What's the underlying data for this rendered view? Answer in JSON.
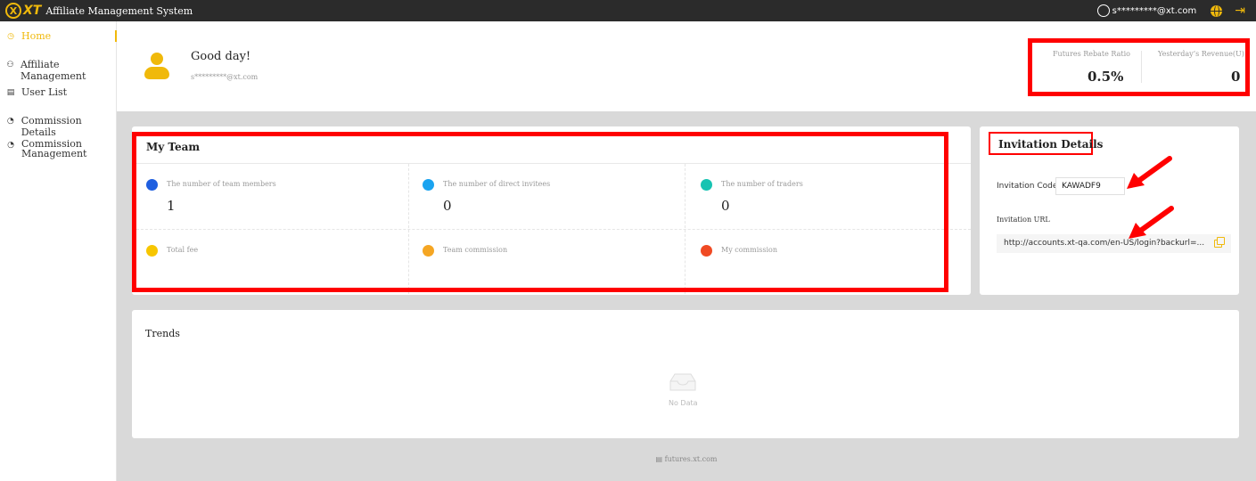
{
  "topbar": {
    "logo_mark": "X",
    "logo_text": "XT",
    "title": "Affiliate Management System",
    "user_email": "s*********@xt.com"
  },
  "sidebar": {
    "items": [
      {
        "label": "Home",
        "icon": "home-icon",
        "active": true
      },
      {
        "label": "Affiliate Management",
        "icon": "users-icon"
      },
      {
        "label": "User List",
        "icon": "list-icon"
      },
      {
        "label": "Commission Details",
        "icon": "pie-chart-icon"
      },
      {
        "label": "Commission Management",
        "icon": "pie-chart-icon"
      }
    ]
  },
  "header": {
    "greeting": "Good day!",
    "email": "s*********@xt.com",
    "stats": [
      {
        "label": "Futures Rebate Ratio",
        "value": "0.5%"
      },
      {
        "label": "Yesterday’s Revenue(U)",
        "value": "0"
      }
    ]
  },
  "team": {
    "title": "My Team",
    "cells": [
      {
        "label": "The number of team members",
        "value": "1",
        "color": "#1f5fe0"
      },
      {
        "label": "The number of direct invitees",
        "value": "0",
        "color": "#1aa3f0"
      },
      {
        "label": "The number of traders",
        "value": "0",
        "color": "#17c3b2"
      },
      {
        "label": "Total fee",
        "value": "",
        "color": "#f7c600"
      },
      {
        "label": "Team commission",
        "value": "",
        "color": "#f5a623"
      },
      {
        "label": "My commission",
        "value": "",
        "color": "#f04a23"
      }
    ]
  },
  "invitation": {
    "title": "Invitation Details",
    "code_label": "Invitation Code",
    "code_value": "KAWADF9",
    "url_label": "Invitation URL",
    "url_value": "http://accounts.xt-qa.com/en-US/login?backurl=..."
  },
  "trends": {
    "title": "Trends",
    "empty_text": "No Data"
  },
  "footer": {
    "text": "futures.xt.com"
  },
  "colors": {
    "accent": "#f0b90b",
    "annotation": "#ff0000"
  }
}
